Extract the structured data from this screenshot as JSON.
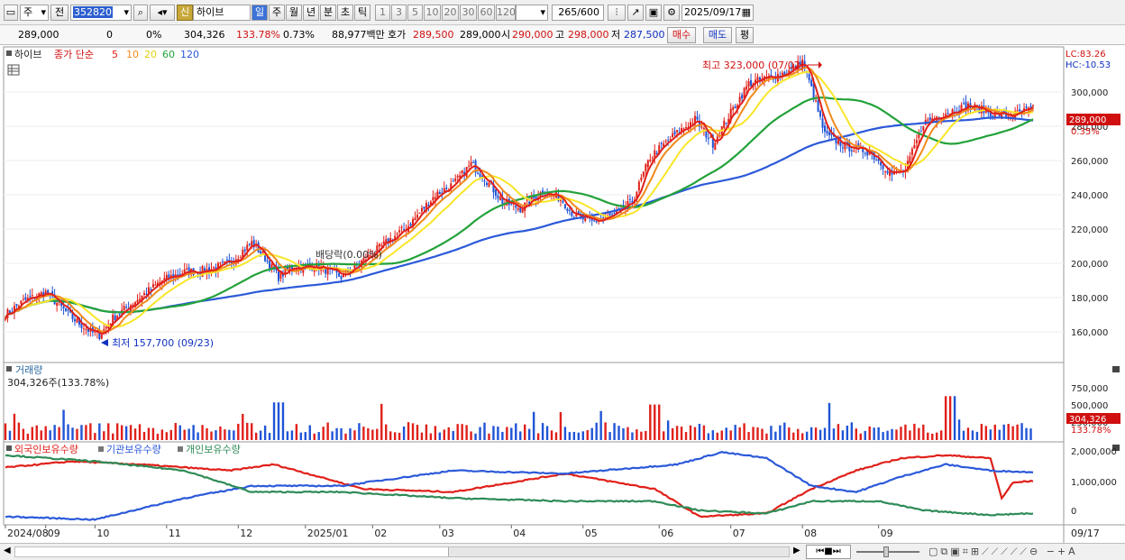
{
  "toolbar": {
    "market": "주",
    "prev_label": "전",
    "code": "352820",
    "credit_badge": "신",
    "stock_name": "하이브",
    "periods": [
      "일",
      "주",
      "월",
      "년",
      "분",
      "초",
      "틱"
    ],
    "active_period": "일",
    "minutes": [
      "1",
      "3",
      "5",
      "10",
      "20",
      "30",
      "60",
      "120"
    ],
    "count": "265",
    "count_total": "/600",
    "date": "2025/09/17"
  },
  "quote": {
    "price": "289,000",
    "change": "0",
    "change_pct": "0%",
    "volume": "304,326",
    "volume_ratio": "133.78%",
    "turnover_pct": "0.73%",
    "amount": "88,977백만",
    "hoga_label": "호가",
    "ask": "289,500",
    "bid": "289,000",
    "open_label": "시",
    "open": "290,000",
    "high_label": "고",
    "high": "298,000",
    "low_label": "저",
    "low": "287,500",
    "buy": "매수",
    "sell": "매도",
    "avg": "평"
  },
  "price_panel": {
    "name": "하이브",
    "ma_title": "종가 단순",
    "ma_periods": [
      "5",
      "10",
      "20",
      "60",
      "120"
    ],
    "lc": "LC:83.26",
    "hc": "HC:-10.53",
    "high_note": "최고 323,000 (07/02)",
    "low_note": "최저 157,700 (09/23)",
    "dividend_note": "배당락(0.00%)",
    "last_price": "289,000",
    "last_pct": "0.35%",
    "y_labels": [
      "300,000",
      "280,000",
      "260,000",
      "240,000",
      "220,000",
      "200,000",
      "180,000",
      "160,000"
    ]
  },
  "volume_panel": {
    "title": "거래량",
    "info": "304,326주(133.78%)",
    "y_labels": [
      "750,000",
      "500,000",
      "250,000"
    ],
    "last": "304,326",
    "last_pct": "133.78%"
  },
  "holding_panel": {
    "series": [
      "외국인보유수량",
      "기관보유수량",
      "개인보유수량"
    ],
    "y_labels": [
      "2,000,000",
      "1,000,000",
      "0"
    ]
  },
  "x_axis": {
    "labels": [
      "2024/08",
      "09",
      "10",
      "11",
      "12",
      "2025/01",
      "02",
      "03",
      "04",
      "05",
      "06",
      "07",
      "08",
      "09"
    ],
    "right_label": "09/17"
  },
  "colors": {
    "up": "#e0201a",
    "down": "#1f54d6",
    "ma5": "#e0201a",
    "ma10": "#f08a1c",
    "ma20": "#f8e628",
    "ma60": "#23a23a",
    "ma120": "#2b59d9",
    "foreign": "#e0201a",
    "institution": "#2b59d9",
    "individual": "#2e8b57"
  },
  "chart_data": {
    "type": "candlestick",
    "x_months": [
      "2024/08",
      "09",
      "10",
      "11",
      "12",
      "2025/01",
      "02",
      "03",
      "04",
      "05",
      "06",
      "07",
      "08",
      "09"
    ],
    "anchors_close": [
      [
        0,
        170000
      ],
      [
        8,
        178000
      ],
      [
        18,
        183000
      ],
      [
        30,
        168000
      ],
      [
        38,
        160000
      ],
      [
        42,
        158000
      ],
      [
        48,
        168000
      ],
      [
        60,
        180000
      ],
      [
        70,
        190000
      ],
      [
        80,
        195000
      ],
      [
        90,
        196000
      ],
      [
        100,
        200000
      ],
      [
        110,
        212000
      ],
      [
        115,
        205000
      ],
      [
        122,
        192000
      ],
      [
        128,
        198000
      ],
      [
        140,
        198000
      ],
      [
        150,
        192000
      ],
      [
        158,
        200000
      ],
      [
        170,
        212000
      ],
      [
        180,
        222000
      ],
      [
        192,
        240000
      ],
      [
        200,
        246000
      ],
      [
        208,
        258000
      ],
      [
        214,
        250000
      ],
      [
        222,
        236000
      ],
      [
        230,
        232000
      ],
      [
        240,
        242000
      ],
      [
        248,
        238000
      ],
      [
        254,
        228000
      ],
      [
        262,
        224000
      ],
      [
        272,
        228000
      ],
      [
        280,
        236000
      ],
      [
        288,
        262000
      ],
      [
        298,
        274000
      ],
      [
        308,
        284000
      ],
      [
        316,
        270000
      ],
      [
        324,
        288000
      ],
      [
        332,
        305000
      ],
      [
        340,
        308000
      ],
      [
        350,
        312000
      ],
      [
        356,
        318000
      ],
      [
        360,
        302000
      ],
      [
        366,
        275000
      ],
      [
        376,
        268000
      ],
      [
        386,
        265000
      ],
      [
        396,
        252000
      ],
      [
        402,
        254000
      ],
      [
        410,
        282000
      ],
      [
        420,
        288000
      ],
      [
        430,
        292000
      ],
      [
        440,
        288000
      ],
      [
        448,
        286000
      ],
      [
        456,
        289000
      ]
    ],
    "volume_scale_max": 1000000,
    "holding_scale": [
      -200000,
      2200000
    ]
  }
}
